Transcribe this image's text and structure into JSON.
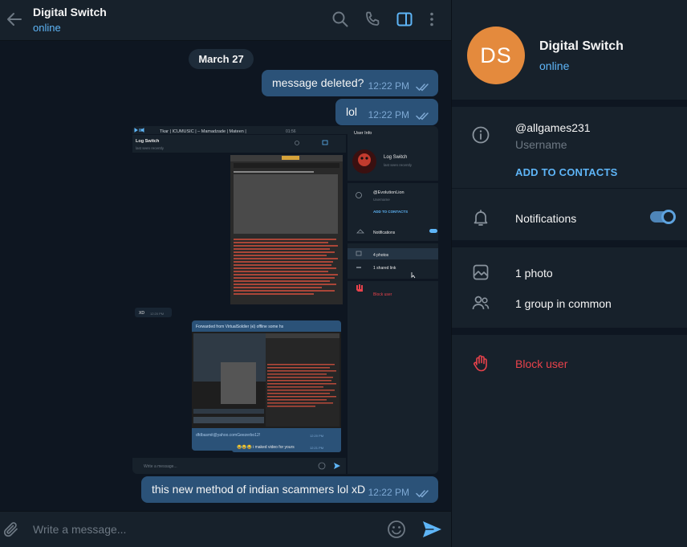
{
  "header": {
    "title": "Digital Switch",
    "status": "online"
  },
  "chat": {
    "date": "March 27",
    "messages": [
      {
        "text": "message deleted?",
        "time": "12:22 PM",
        "read": true
      },
      {
        "text": "lol",
        "time": "12:22 PM",
        "read": true
      },
      {
        "text": "this new method of indian scammers lol xD",
        "time": "12:22 PM",
        "read": true
      }
    ],
    "screenshot": {
      "player": "Tkar | ICUMUSIC | – Mamadzade | Mateen |",
      "player_time": "01:56",
      "chat_title": "Log Switch",
      "chat_status": "last seen recently",
      "info_title": "User Info",
      "profile_name": "Log Switch",
      "profile_status": "last seen recently",
      "username": "@EvolutionLion",
      "username_label": "Username",
      "add_contacts": "ADD TO CONTACTS",
      "notifications": "Notifications",
      "photos": "4 photos",
      "links": "1 shared link",
      "block": "Block user",
      "xd_text": "XD",
      "xd_time": "12:20 PM",
      "forward_label": "Forwarded from VirtualSoldier (𝔰𝔩) offline some hs",
      "email_text": "dfdbasmit@yahoo.comGeezerbo12!",
      "email_time": "12:20 PM",
      "video_text": "😂😂😂 i maked video for yours",
      "video_time": "12:21 PM",
      "composer": "Write a message..."
    }
  },
  "composer": {
    "placeholder": "Write a message..."
  },
  "profile": {
    "initials": "DS",
    "name": "Digital Switch",
    "status": "online",
    "username": "@allgames231",
    "username_label": "Username",
    "add_contacts": "ADD TO CONTACTS",
    "notifications": "Notifications",
    "notifications_on": true,
    "photos": "1 photo",
    "groups": "1 group in common",
    "block": "Block user"
  },
  "colors": {
    "accent": "#5eb5f7",
    "bubble_out": "#2b5278",
    "avatar": "#e48a3d",
    "danger": "#e8424b",
    "panel": "#17212b",
    "background": "#0e1621"
  }
}
